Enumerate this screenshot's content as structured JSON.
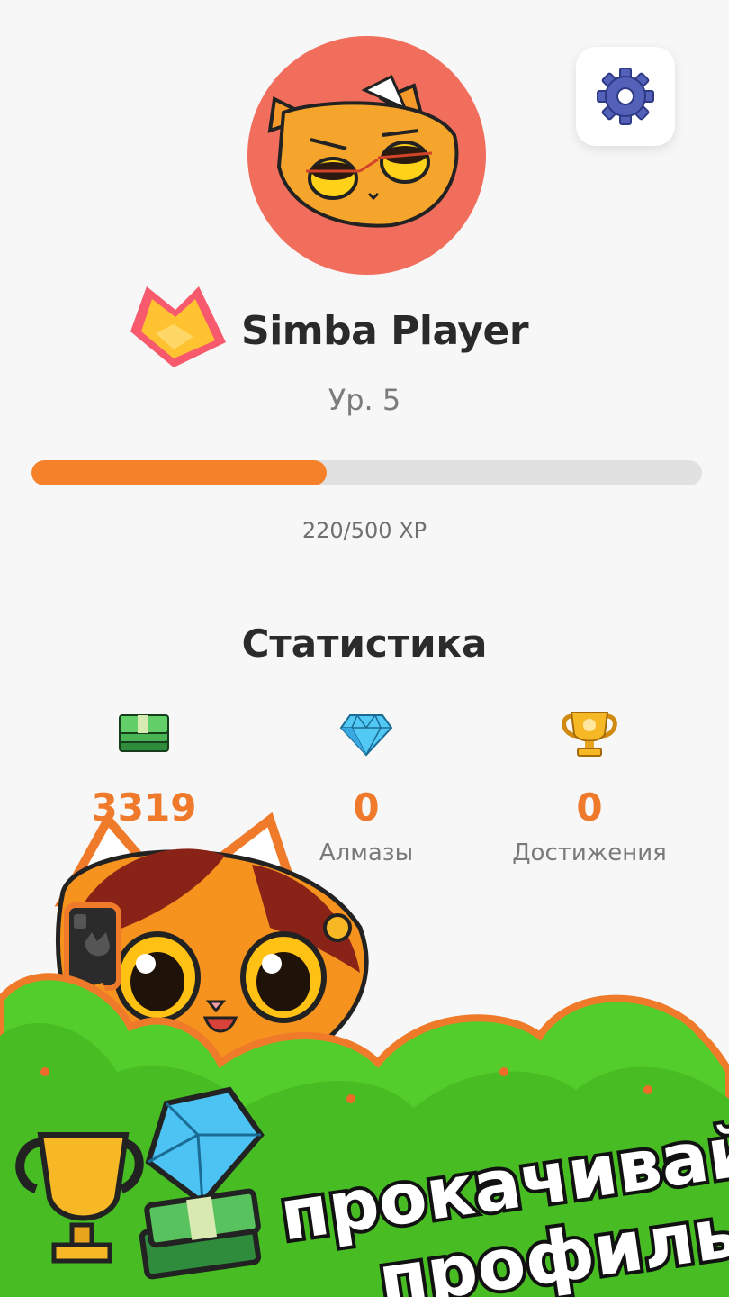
{
  "profile": {
    "name": "Simba Player",
    "level": "Ур. 5",
    "xp_text": "220/500 XP",
    "xp_progress": 0.44
  },
  "stats": {
    "title": "Статистика",
    "items": [
      {
        "icon": "money-stack-icon",
        "value": "3319",
        "label": ""
      },
      {
        "icon": "diamond-icon",
        "value": "0",
        "label": "Алмазы"
      },
      {
        "icon": "trophy-icon",
        "value": "0",
        "label": "Достижения"
      }
    ]
  },
  "promo": {
    "line1": "прокачивай",
    "line2": "профиль!"
  },
  "colors": {
    "accent": "#f5822a",
    "avatar_bg": "#f16d5c",
    "promo_green": "#4fd02c"
  }
}
